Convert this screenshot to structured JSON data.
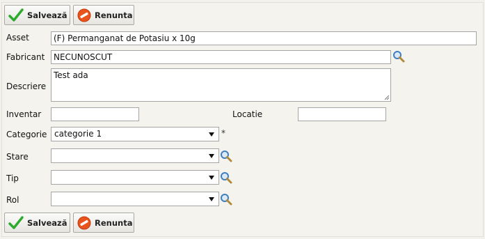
{
  "toolbar_top": {
    "save_label": "Salvează",
    "cancel_label": "Renunta"
  },
  "toolbar_bottom": {
    "save_label": "Salvează",
    "cancel_label": "Renunta"
  },
  "form": {
    "asset": {
      "label": "Asset",
      "value": "(F) Permanganat de Potasiu x 10g"
    },
    "fabricant": {
      "label": "Fabricant",
      "value": "NECUNOSCUT"
    },
    "descriere": {
      "label": "Descriere",
      "value": "Test ada"
    },
    "inventar": {
      "label": "Inventar",
      "value": ""
    },
    "locatie": {
      "label": "Locatie",
      "value": ""
    },
    "categorie": {
      "label": "Categorie",
      "value": "categorie 1",
      "required_mark": "*"
    },
    "stare": {
      "label": "Stare",
      "value": ""
    },
    "tip": {
      "label": "Tip",
      "value": ""
    },
    "rol": {
      "label": "Rol",
      "value": ""
    }
  },
  "icons": {
    "save": "check-icon",
    "cancel": "no-entry-icon",
    "lookup": "magnifier-icon"
  },
  "colors": {
    "check_green": "#2eaa2e",
    "cancel_orange": "#e8541c",
    "magnifier_blue": "#3f7fbf",
    "background": "#f4f3ed"
  }
}
